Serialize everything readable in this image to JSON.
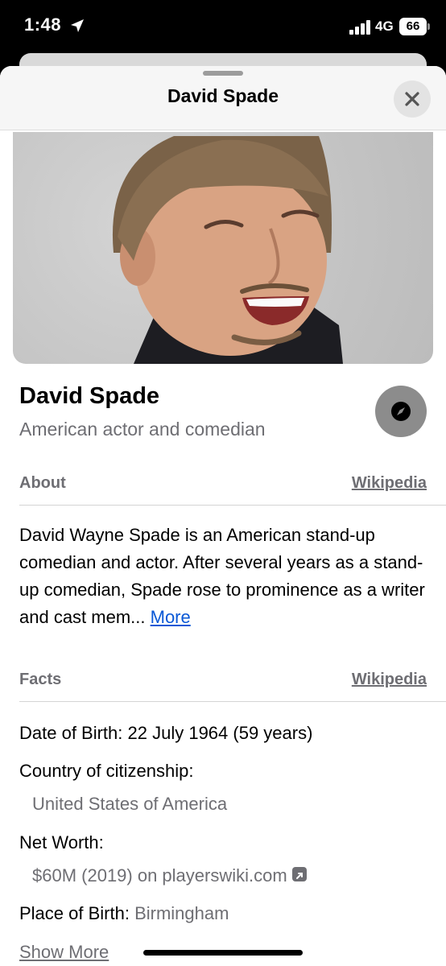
{
  "status_bar": {
    "time": "1:48",
    "network": "4G",
    "battery": "66"
  },
  "sheet": {
    "title": "David Spade"
  },
  "person": {
    "name": "David Spade",
    "subtitle": "American actor and comedian"
  },
  "about": {
    "label": "About",
    "source_link": "Wikipedia",
    "text": "David Wayne Spade is an American stand-up comedian and actor. After several years as a stand-up comedian, Spade rose to prominence as a writer and cast mem... ",
    "more_label": "More"
  },
  "facts": {
    "label": "Facts",
    "source_link": "Wikipedia",
    "date_of_birth_label": "Date of Birth:",
    "date_of_birth_value": "22 July 1964 (59 years)",
    "citizenship_label": "Country of citizenship:",
    "citizenship_value": "United States of America",
    "net_worth_label": "Net Worth:",
    "net_worth_value": "$60M (2019) on playerswiki.com",
    "place_of_birth_label": "Place of Birth:",
    "place_of_birth_value": "Birmingham",
    "show_more_label": "Show More"
  },
  "icons": {
    "location": "location-arrow-icon",
    "signal": "cellular-signal-icon",
    "close": "close-icon",
    "compass": "compass-icon",
    "external": "external-link-icon"
  },
  "colors": {
    "link_blue": "#0a58d6",
    "secondary_text": "#6e6e73"
  }
}
